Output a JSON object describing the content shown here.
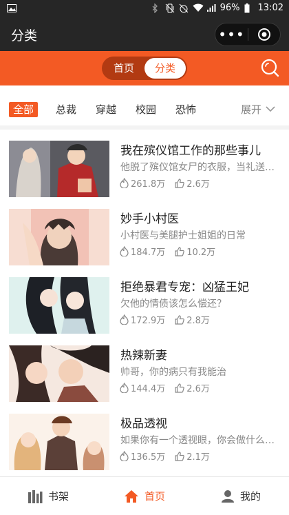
{
  "status_bar": {
    "battery": "96%",
    "time": "13:02"
  },
  "title_bar": {
    "title": "分类",
    "more_glyph": "•••"
  },
  "top_nav": {
    "tabs": [
      {
        "label": "首页"
      },
      {
        "label": "分类"
      }
    ],
    "active_index": 1
  },
  "categories": {
    "items": [
      "全部",
      "总裁",
      "穿越",
      "校园",
      "恐怖"
    ],
    "active_index": 0,
    "expand_label": "展开"
  },
  "comics": [
    {
      "title": "我在殡仪馆工作的那些事儿",
      "desc": "他脱了殡仪馆女尸的衣服，当礼送…",
      "views": "261.8万",
      "likes": "2.6万"
    },
    {
      "title": "妙手小村医",
      "desc": "小村医与美腿护士姐姐的日常",
      "views": "184.7万",
      "likes": "10.2万"
    },
    {
      "title": "拒绝暴君专宠：凶猛王妃",
      "desc": "欠他的情债该怎么偿还？",
      "views": "172.9万",
      "likes": "2.8万"
    },
    {
      "title": "热辣新妻",
      "desc": "帅哥，你的病只有我能治",
      "views": "144.4万",
      "likes": "2.6万"
    },
    {
      "title": "极品透视",
      "desc": "如果你有一个透视眼，你会做什么…",
      "views": "136.5万",
      "likes": "2.1万"
    }
  ],
  "bottom_tabs": [
    {
      "label": "书架",
      "icon": "bookshelf-icon"
    },
    {
      "label": "首页",
      "icon": "home-icon"
    },
    {
      "label": "我的",
      "icon": "user-icon"
    }
  ],
  "colors": {
    "accent": "#f35a24",
    "dark_bar": "#262626",
    "muted_text": "#888888"
  }
}
